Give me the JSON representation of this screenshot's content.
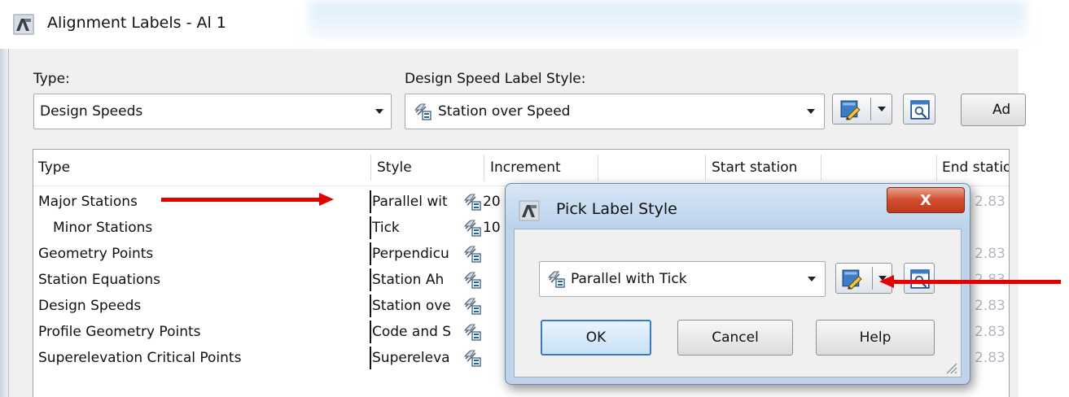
{
  "window": {
    "title": "Alignment Labels - Al 1"
  },
  "type_field": {
    "label": "Type:",
    "value": "Design Speeds"
  },
  "style_field": {
    "label": "Design Speed Label Style:",
    "value": "Station over Speed"
  },
  "add_button": {
    "label": "Ad"
  },
  "table": {
    "columns": [
      "Type",
      "Style",
      "Increment",
      "Start station",
      "End statio"
    ],
    "rows": [
      {
        "type": "Major Stations",
        "style": "Parallel wit",
        "increment": "20",
        "end": "2.83"
      },
      {
        "type": "Minor Stations",
        "style": "Tick",
        "increment": "10",
        "end": ""
      },
      {
        "type": "Geometry Points",
        "style": "Perpendicu",
        "increment": "",
        "end": "2.83"
      },
      {
        "type": "Station Equations",
        "style": "Station Ah",
        "increment": "",
        "end": "2.83"
      },
      {
        "type": "Design Speeds",
        "style": "Station ove",
        "increment": "",
        "end": "2.83"
      },
      {
        "type": "Profile Geometry Points",
        "style": "Code and S",
        "increment": "",
        "end": "2.83"
      },
      {
        "type": "Superelevation Critical Points",
        "style": "Supereleva",
        "increment": "",
        "end": "2.83"
      }
    ]
  },
  "dialog": {
    "title": "Pick Label Style",
    "close_label": "X",
    "style_value": "Parallel with Tick",
    "ok_label": "OK",
    "cancel_label": "Cancel",
    "help_label": "Help"
  },
  "colors": {
    "annotation_arrow": "#e50000",
    "dialog_frame": "#bfd4ea",
    "close_button": "#c8452a",
    "selection_blue": "#3b79c7"
  },
  "icons": [
    "autocad-logo-icon",
    "label-style-icon",
    "edit-style-icon",
    "dropdown-arrow-icon",
    "preview-style-icon",
    "resize-grip-icon"
  ]
}
